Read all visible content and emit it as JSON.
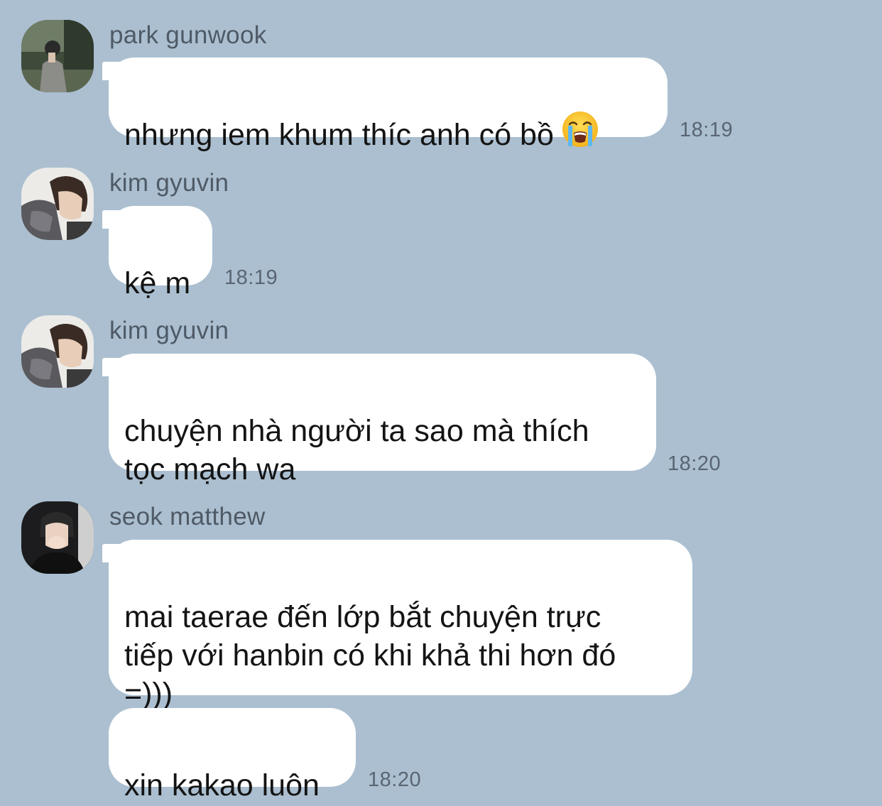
{
  "messages": [
    {
      "sender": "park gunwook",
      "text": "nhưng iem khum thíc anh có bồ",
      "emoji": "loudly-crying-face",
      "time": "18:19"
    },
    {
      "sender": "kim gyuvin",
      "text": "kệ m",
      "time": "18:19"
    },
    {
      "sender": "kim gyuvin",
      "text": "chuyện nhà người ta sao mà thích\ntọc mạch wa",
      "time": "18:20"
    },
    {
      "sender": "seok matthew",
      "text": "mai taerae đến lớp bắt chuyện trực\ntiếp với hanbin có khi khả thi hơn đó\n=)))"
    },
    {
      "text": "xin kakao luôn",
      "time": "18:20"
    }
  ],
  "colors": {
    "background": "#abbfd0",
    "bubble": "#ffffff",
    "sender_text": "#4f5a66",
    "time_text": "#5a6573"
  }
}
